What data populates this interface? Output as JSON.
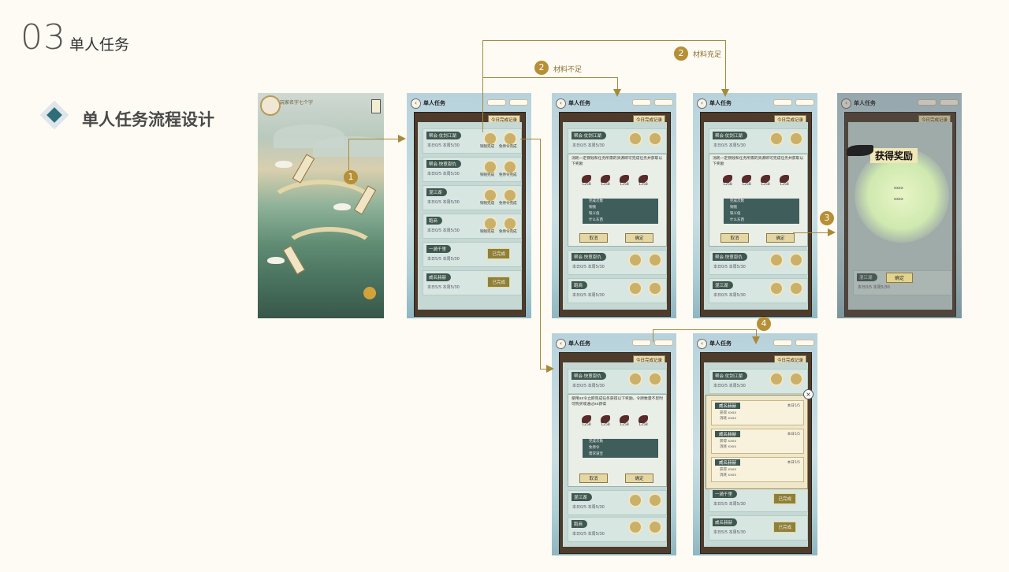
{
  "header": {
    "number": "03",
    "title": "单人任务",
    "section_title": "单人任务流程设计"
  },
  "map": {
    "player_name": "玩家名字七个字",
    "banners": [
      "帮会",
      "单人任务",
      "北国冰原"
    ]
  },
  "phone": {
    "title": "单人任务",
    "record_button": "今日完成记录",
    "resource_value": "00000",
    "confirm": "确定",
    "cancel": "取消",
    "complete_silver": "铜钱完成",
    "complete_token": "免侍令完成",
    "completed_label": "已完成"
  },
  "tasks": [
    {
      "name": "帮会·仗剑江湖",
      "counts": "本日0/5  本周5/30"
    },
    {
      "name": "帮会·快意恩仇",
      "counts": "本日0/5  本周5/30"
    },
    {
      "name": "混江湖",
      "counts": "本日0/5  本周5/30"
    },
    {
      "name": "跑商",
      "counts": "本日0/5  本周5/30"
    },
    {
      "name": "一骑千里",
      "counts": "本日5/5  本周5/30"
    },
    {
      "name": "威名赫赫",
      "counts": "本日5/5  本周5/30"
    }
  ],
  "popup": {
    "desc_silver": "消耗一定铜钱和任务所需的资源即可完成任务并获取以下奖励",
    "desc_token": "使用xx令立即完成任务获得以下奖励。令牌数量不足时可购买或通过xx获得",
    "item_value": "1258",
    "token_item_value": "1258",
    "rows": [
      "完成次数",
      "铜钱",
      "铁义值",
      "什么东西"
    ],
    "token_rows": [
      "完成次数",
      "免侍令",
      "需求道宝"
    ],
    "count": "1",
    "max": "最大",
    "cost": "xxxx"
  },
  "reward": {
    "title": "获得奖励",
    "items": [
      "xxxx",
      "xxxx"
    ]
  },
  "record_popup": {
    "title": "威名赫赫",
    "count": "本日5/5",
    "lines": [
      "获得 xxxx",
      "消耗 xxxx"
    ]
  },
  "annotations": {
    "step1": "1",
    "step2a": "2",
    "step2a_label": "材料不足",
    "step2b": "2",
    "step2b_label": "材料充足",
    "step3": "3",
    "step4": "4"
  }
}
